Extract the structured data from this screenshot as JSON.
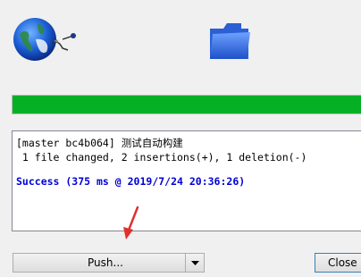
{
  "icons": {
    "globe": "globe-icon",
    "folder": "folder-icon"
  },
  "progress": {
    "value": 1.0,
    "color": "#06b025"
  },
  "log": {
    "commit_line": "[master bc4b064] 测试自动构建",
    "stats_line": " 1 file changed, 2 insertions(+), 1 deletion(-)",
    "result_line": "Success (375 ms @ 2019/7/24 20:36:26)",
    "result_color": "#0000d6"
  },
  "buttons": {
    "push_label": "Push...",
    "close_label": "Close"
  }
}
